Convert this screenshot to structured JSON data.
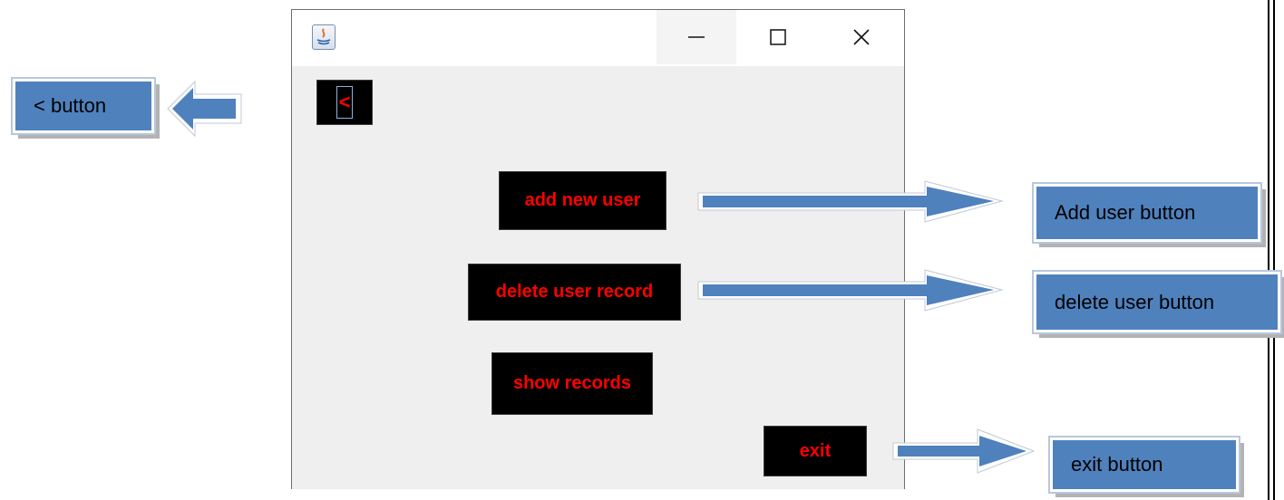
{
  "window": {
    "controls": {
      "minimize": "—",
      "maximize": "☐",
      "close": "✕"
    },
    "buttons": {
      "back_label": "<",
      "add_label": "add new user",
      "delete_label": "delete user record",
      "show_label": "show records",
      "exit_label": "exit"
    }
  },
  "callouts": {
    "back": "< button",
    "add": "Add user button",
    "delete": "delete user button",
    "exit": "exit button"
  },
  "colors": {
    "button_bg": "#000000",
    "button_text": "#ff0000",
    "callout_fill": "#4f81bd",
    "arrow_fill": "#4f81bd"
  },
  "icons": [
    "java-app-icon",
    "minimize-icon",
    "maximize-icon",
    "close-icon",
    "arrow-left-icon",
    "arrow-right-icon"
  ]
}
